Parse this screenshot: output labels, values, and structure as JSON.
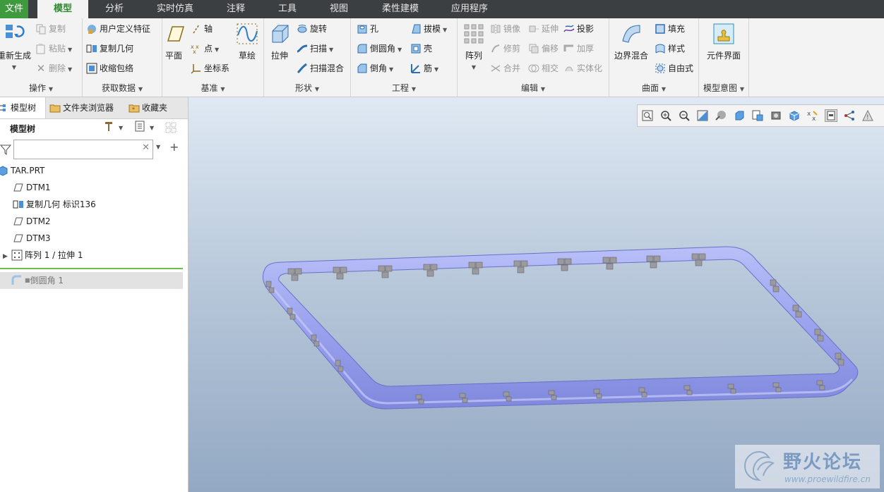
{
  "menubar": {
    "items": [
      "文件",
      "模型",
      "分析",
      "实时仿真",
      "注释",
      "工具",
      "视图",
      "柔性建模",
      "应用程序"
    ]
  },
  "ribbon": {
    "operations": {
      "label": "操作",
      "regen": "重新生成",
      "copy": "复制",
      "paste": "粘贴",
      "delete": "删除"
    },
    "get_data": {
      "label": "获取数据",
      "udf": "用户定义特征",
      "copy_geom": "复制几何",
      "shrinkwrap": "收缩包络"
    },
    "datum": {
      "label": "基准",
      "plane": "平面",
      "axis": "轴",
      "point": "点",
      "csys": "坐标系",
      "sketch": "草绘"
    },
    "shapes": {
      "label": "形状",
      "extrude": "拉伸",
      "revolve": "旋转",
      "sweep": "扫描",
      "swept_blend": "扫描混合"
    },
    "engineering": {
      "label": "工程",
      "hole": "孔",
      "round": "倒圆角",
      "chamfer": "倒角",
      "draft": "拔模",
      "shell": "壳",
      "rib": "筋"
    },
    "editing": {
      "label": "编辑",
      "pattern": "阵列",
      "mirror": "镜像",
      "extend": "延伸",
      "project": "投影",
      "trim": "修剪",
      "offset": "偏移",
      "thicken": "加厚",
      "merge": "合并",
      "intersect": "相交",
      "solidify": "实体化"
    },
    "surfaces": {
      "label": "曲面",
      "boundary_blend": "边界混合",
      "fill": "填充",
      "style": "样式",
      "freestyle": "自由式"
    },
    "model_intent": {
      "label": "模型意图",
      "component_interface": "元件界面"
    }
  },
  "left_tabs": {
    "model_tree": "模型树",
    "folder_browser": "文件夹浏览器",
    "favorites": "收藏夹"
  },
  "model_tree": {
    "header": "模型树",
    "search_value": "",
    "items": [
      {
        "label": "TAR.PRT",
        "icon": "part-icon"
      },
      {
        "label": "DTM1",
        "icon": "datum-plane-icon"
      },
      {
        "label": "复制几何 标识136",
        "icon": "copy-geom-icon"
      },
      {
        "label": "DTM2",
        "icon": "datum-plane-icon"
      },
      {
        "label": "DTM3",
        "icon": "datum-plane-icon"
      },
      {
        "label": "阵列 1 / 拉伸 1",
        "icon": "pattern-icon"
      },
      {
        "label": "倒圆角 1",
        "icon": "round-icon"
      }
    ]
  },
  "watermark": {
    "title": "野火论坛",
    "url": "www.proewildfire.cn"
  },
  "colors": {
    "menubar_bg": "#3c3f41",
    "file_tab": "#3d9a3d",
    "model_color": "#9ea6f0",
    "insert_line": "#6bbf4a"
  }
}
